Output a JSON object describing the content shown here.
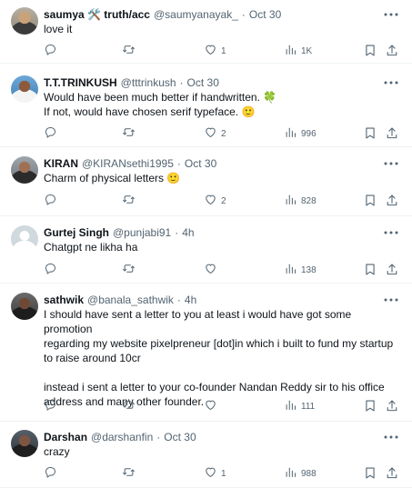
{
  "tweets": [
    {
      "name": "saumya 🛠️ truth/acc",
      "handle": "@saumyanayak_",
      "dot": "·",
      "time": "Oct 30",
      "text": "love it",
      "likes": "1",
      "views": "1K"
    },
    {
      "name": "T.T.TRINKUSH",
      "handle": "@tttrinkush",
      "dot": "·",
      "time": "Oct 30",
      "text": "Would have been much better if handwritten. 🍀\nIf not, would have chosen serif typeface. 🙂",
      "likes": "2",
      "views": "996"
    },
    {
      "name": "KIRAN",
      "handle": "@KIRANsethi1995",
      "dot": "·",
      "time": "Oct 30",
      "text": "Charm of physical letters 🙂",
      "likes": "2",
      "views": "828"
    },
    {
      "name": "Gurtej Singh",
      "handle": "@punjabi91",
      "dot": "·",
      "time": "4h",
      "text": "Chatgpt ne likha ha",
      "likes": "",
      "views": "138"
    },
    {
      "name": "sathwik",
      "handle": "@banala_sathwik",
      "dot": "·",
      "time": "4h",
      "text": "I should have sent a letter to you at least i would have got some promotion\nregarding my website pixelpreneur [dot]in which i built to fund my startup\nto raise around 10cr\n\ninstead i sent a letter to your co-founder Nandan Reddy sir to his office\naddress and many other founder.",
      "likes": "",
      "views": "111"
    },
    {
      "name": "Darshan",
      "handle": "@darshanfin",
      "dot": "·",
      "time": "Oct 30",
      "text": "crazy",
      "likes": "1",
      "views": "988"
    }
  ],
  "colors": {
    "text": "#0f1419",
    "secondary": "#536471",
    "divider": "#eff3f4"
  },
  "icons": [
    "more-icon",
    "reply-icon",
    "retweet-icon",
    "like-icon",
    "views-icon",
    "bookmark-icon",
    "share-icon"
  ]
}
